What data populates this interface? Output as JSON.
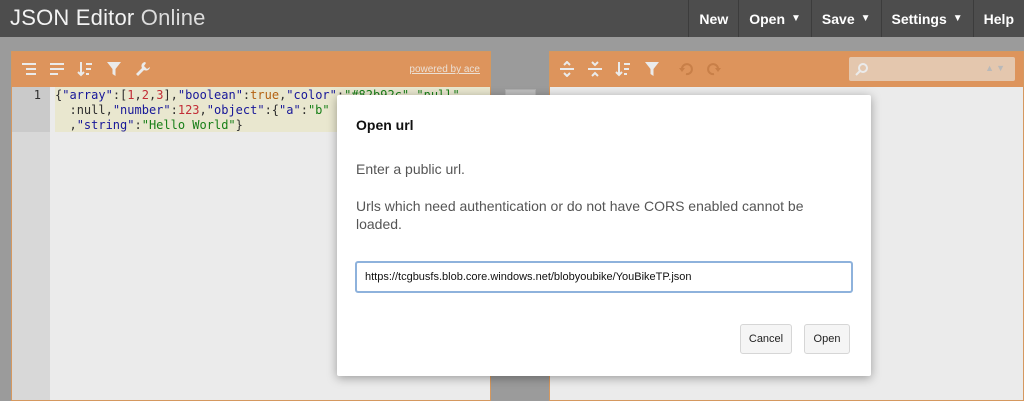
{
  "app": {
    "title_main": "JSON Editor",
    "title_light": "Online"
  },
  "menu": {
    "items": [
      {
        "label": "New",
        "dropdown": false
      },
      {
        "label": "Open",
        "dropdown": true
      },
      {
        "label": "Save",
        "dropdown": true
      },
      {
        "label": "Settings",
        "dropdown": true
      },
      {
        "label": "Help",
        "dropdown": false
      }
    ],
    "caret": "▼"
  },
  "left_panel": {
    "toolbar_icons": [
      "format-icon",
      "compact-icon",
      "sort-icon",
      "filter-icon",
      "repair-icon"
    ],
    "powered_by": "powered by ace",
    "line_number": "1",
    "code": {
      "line1": "{\"array\":[1,2,3],\"boolean\":true,\"color\":\"#82b92c\",\"null\"",
      "line2": "  :null,\"number\":123,\"object\":{\"a\":\"b\"",
      "line3": "  ,\"string\":\"Hello World\"}"
    }
  },
  "right_panel": {
    "toolbar_icons": [
      "expand-all-icon",
      "collapse-all-icon",
      "sort-icon",
      "filter-icon",
      "undo-icon",
      "redo-icon"
    ],
    "search_placeholder": "",
    "search_arrows": "▲▼"
  },
  "modal": {
    "title": "Open url",
    "text1": "Enter a public url.",
    "text2": "Urls which need authentication or do not have CORS enabled cannot be loaded.",
    "url_value": "https://tcgbusfs.blob.core.windows.net/blobyoubike/YouBikeTP.json",
    "cancel_label": "Cancel",
    "open_label": "Open"
  },
  "colors": {
    "topbar": "#4d4d4d",
    "toolbar_orange": "#f0a164",
    "input_focus": "#8eb2dc"
  }
}
